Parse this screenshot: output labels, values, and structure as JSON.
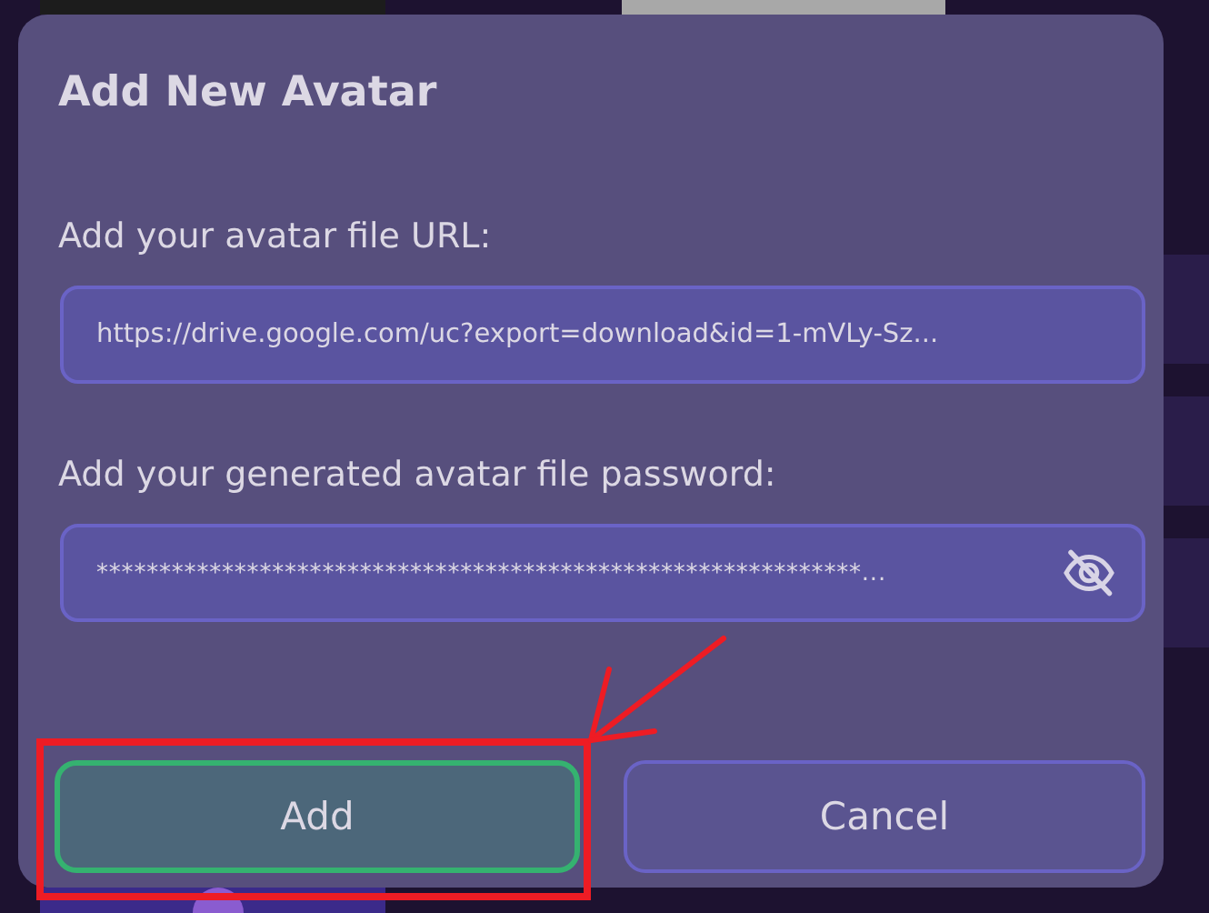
{
  "dialog": {
    "title": "Add New Avatar",
    "fields": [
      {
        "kind": "text",
        "label": "Add your avatar file URL:",
        "value": "https://drive.google.com/uc?export=download&id=1-mVLy-Sz..."
      },
      {
        "kind": "password",
        "label": "Add your generated avatar file password:",
        "value": "*************************************************************..."
      }
    ],
    "buttons": [
      {
        "kind": "primary",
        "label": "Add"
      },
      {
        "kind": "secondary",
        "label": "Cancel"
      }
    ]
  }
}
